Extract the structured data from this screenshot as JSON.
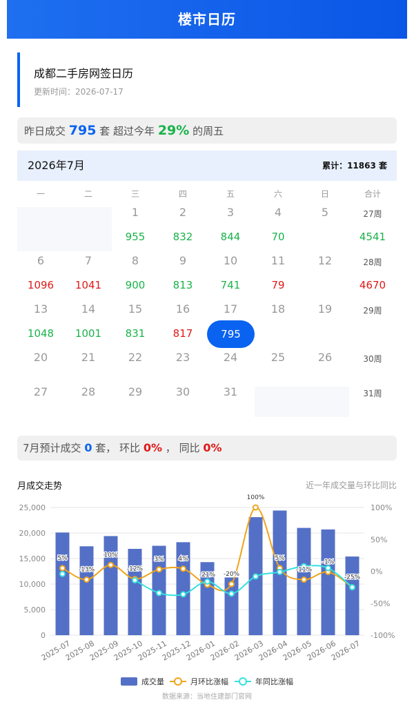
{
  "header": {
    "title": "楼市日历"
  },
  "card": {
    "title": "成都二手房网签日历",
    "updated": "更新时间：2026-07-17"
  },
  "summary": {
    "prefix": "昨日成交",
    "count": "795",
    "unit_mid": "套 超过今年",
    "percent": "29%",
    "suffix": "的周五"
  },
  "calendar": {
    "month_label": "2026年7月",
    "total_label": "累计：11863 套",
    "weekdays": [
      "一",
      "二",
      "三",
      "四",
      "五",
      "六",
      "日",
      "合计"
    ],
    "rows": [
      {
        "week": "27周",
        "week_total": "4541",
        "week_total_color": "g",
        "cells": [
          {
            "d": "",
            "v": "",
            "c": ""
          },
          {
            "d": "",
            "v": "",
            "c": ""
          },
          {
            "d": "1",
            "v": "955",
            "c": "g"
          },
          {
            "d": "2",
            "v": "832",
            "c": "g"
          },
          {
            "d": "3",
            "v": "844",
            "c": "g"
          },
          {
            "d": "4",
            "v": "70",
            "c": "g"
          },
          {
            "d": "5",
            "v": "",
            "c": ""
          }
        ]
      },
      {
        "week": "28周",
        "week_total": "4670",
        "week_total_color": "r",
        "cells": [
          {
            "d": "6",
            "v": "1096",
            "c": "r"
          },
          {
            "d": "7",
            "v": "1041",
            "c": "r"
          },
          {
            "d": "8",
            "v": "900",
            "c": "g"
          },
          {
            "d": "9",
            "v": "813",
            "c": "g"
          },
          {
            "d": "10",
            "v": "741",
            "c": "g"
          },
          {
            "d": "11",
            "v": "79",
            "c": "r"
          },
          {
            "d": "12",
            "v": "",
            "c": ""
          }
        ]
      },
      {
        "week": "29周",
        "week_total": "",
        "week_total_color": "",
        "cells": [
          {
            "d": "13",
            "v": "1048",
            "c": "g"
          },
          {
            "d": "14",
            "v": "1001",
            "c": "g"
          },
          {
            "d": "15",
            "v": "831",
            "c": "g"
          },
          {
            "d": "16",
            "v": "817",
            "c": "r"
          },
          {
            "d": "17",
            "v": "795",
            "c": "sel"
          },
          {
            "d": "18",
            "v": "",
            "c": ""
          },
          {
            "d": "19",
            "v": "",
            "c": ""
          }
        ]
      },
      {
        "week": "30周",
        "week_total": "",
        "week_total_color": "",
        "cells": [
          {
            "d": "20",
            "v": "",
            "c": ""
          },
          {
            "d": "21",
            "v": "",
            "c": ""
          },
          {
            "d": "22",
            "v": "",
            "c": ""
          },
          {
            "d": "23",
            "v": "",
            "c": ""
          },
          {
            "d": "24",
            "v": "",
            "c": ""
          },
          {
            "d": "25",
            "v": "",
            "c": ""
          },
          {
            "d": "26",
            "v": "",
            "c": ""
          }
        ]
      },
      {
        "week": "31周",
        "week_total": "",
        "week_total_color": "",
        "cells": [
          {
            "d": "27",
            "v": "",
            "c": ""
          },
          {
            "d": "28",
            "v": "",
            "c": ""
          },
          {
            "d": "29",
            "v": "",
            "c": ""
          },
          {
            "d": "30",
            "v": "",
            "c": ""
          },
          {
            "d": "31",
            "v": "",
            "c": ""
          },
          {
            "d": "",
            "v": "",
            "c": ""
          },
          {
            "d": "",
            "v": "",
            "c": ""
          }
        ]
      }
    ]
  },
  "forecast": {
    "prefix": "7月预计成交",
    "count": "0",
    "unit": "套，",
    "mom_label": "环比",
    "mom": "0%",
    "sep": "，",
    "yoy_label": "同比",
    "yoy": "0%"
  },
  "chart_header": {
    "title": "月成交走势",
    "subtitle": "近一年成交量与环比同比"
  },
  "footer": {
    "source": "数据来源：当地住建部门官网"
  },
  "colors": {
    "bar": "#5470c6",
    "mom": "#f0a41a",
    "yoy": "#33e0e0",
    "accent": "#0a63f0",
    "up": "#e01818",
    "down": "#19b34a"
  },
  "chart_data": {
    "type": "bar",
    "categories": [
      "2025-07",
      "2025-08",
      "2025-09",
      "2025-10",
      "2025-11",
      "2025-12",
      "2026-01",
      "2026-02",
      "2026-03",
      "2026-04",
      "2026-05",
      "2026-06",
      "2026-07"
    ],
    "series": [
      {
        "name": "成交量",
        "type": "bar",
        "axis": "left",
        "values": [
          20100,
          17400,
          19400,
          16900,
          17500,
          18200,
          14300,
          11300,
          23100,
          24400,
          21000,
          20700,
          15400
        ]
      },
      {
        "name": "月环比涨幅",
        "type": "line",
        "axis": "right",
        "values": [
          5,
          -13,
          10,
          -12,
          3,
          4,
          -21,
          -20,
          100,
          5,
          -13,
          -1,
          -25
        ]
      },
      {
        "name": "年同比涨幅",
        "type": "line",
        "axis": "right",
        "values": [
          -4,
          null,
          null,
          -14,
          -34,
          -36,
          -16,
          -35,
          -8,
          -1,
          8,
          5,
          -25
        ]
      }
    ],
    "label_series": "月环比涨幅",
    "labels": [
      "5%",
      "-13%",
      "10%",
      "-12%",
      "3%",
      "4%",
      "-21%",
      "-20%",
      "100%",
      "5%",
      "-11%",
      "-1%",
      "-25%"
    ],
    "left_ticks": [
      "25,000",
      "20,000",
      "15,000",
      "10,000",
      "5,000",
      "0"
    ],
    "right_ticks": [
      "100%",
      "50%",
      "0%",
      "-50%",
      "-100%"
    ],
    "ylim_left": [
      0,
      25000
    ],
    "ylim_right": [
      -100,
      100
    ],
    "legend": "bottom"
  }
}
